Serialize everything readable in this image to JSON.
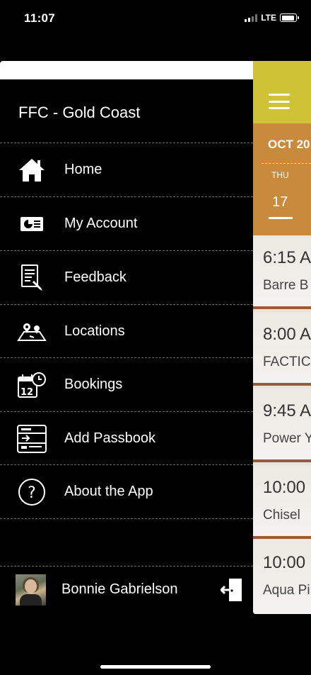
{
  "status": {
    "time": "11:07",
    "network": "LTE",
    "battery_level": 0.9
  },
  "drawer": {
    "club_name": "FFC - Gold Coast",
    "items": [
      {
        "label": "Home",
        "icon": "home-icon"
      },
      {
        "label": "My Account",
        "icon": "account-card-icon"
      },
      {
        "label": "Feedback",
        "icon": "feedback-icon"
      },
      {
        "label": "Locations",
        "icon": "map-pins-icon"
      },
      {
        "label": "Bookings",
        "icon": "calendar-clock-icon"
      },
      {
        "label": "Add Passbook",
        "icon": "passbook-icon"
      },
      {
        "label": "About the App",
        "icon": "question-icon"
      }
    ],
    "user_name": "Bonnie Gabrielson",
    "logout_icon": "logout-door-icon"
  },
  "schedule_peek": {
    "month": "OCT 20",
    "day_of_week": "THU",
    "day_number": "17",
    "classes": [
      {
        "time": "6:15 A",
        "name": "Barre B"
      },
      {
        "time": "8:00 A",
        "name": "FACTIC"
      },
      {
        "time": "9:45 A",
        "name": "Power Y"
      },
      {
        "time": "10:00",
        "name": "Chisel"
      },
      {
        "time": "10:00",
        "name": "Aqua Pi"
      }
    ]
  },
  "colors": {
    "header_yellow": "#cfc237",
    "date_orange": "#c98a3b",
    "drawer_bg": "#000000"
  }
}
